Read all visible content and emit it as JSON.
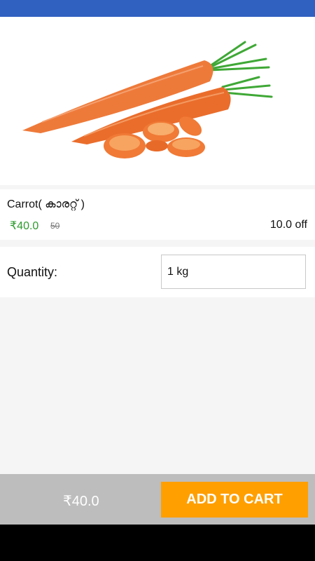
{
  "colors": {
    "status_bar": "#3060c0",
    "price_green": "#2e9b2e",
    "button_orange": "#ff9f00",
    "bottom_bar": "#bdbdbd"
  },
  "product": {
    "image_icon": "carrot-image",
    "name": "Carrot( കാരറ്റ് )",
    "price": "₹40.0",
    "mrp": "50",
    "discount": "10.0 off"
  },
  "quantity": {
    "label": "Quantity:",
    "value": "1 kg"
  },
  "bottom_bar": {
    "total": "₹40.0",
    "add_to_cart_label": "ADD TO CART"
  }
}
